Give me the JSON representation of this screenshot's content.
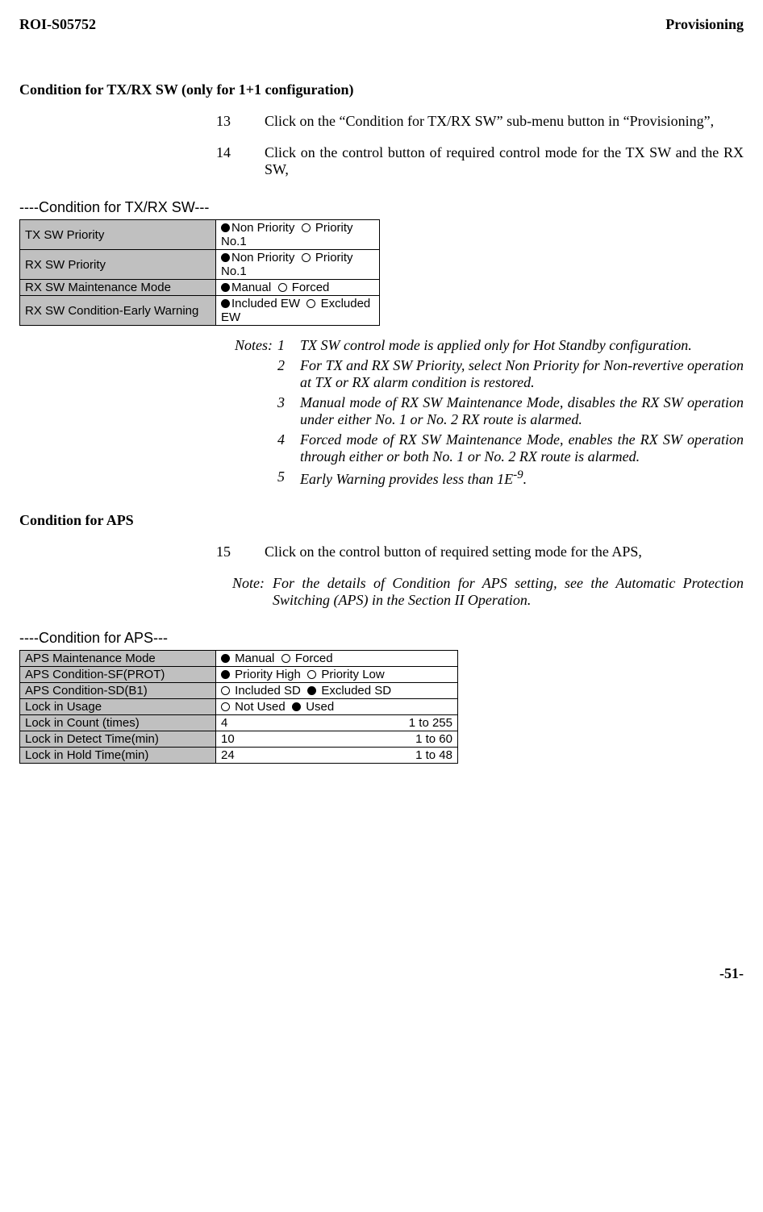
{
  "header": {
    "left": "ROI-S05752",
    "right": "Provisioning"
  },
  "cond_txrx": {
    "title": "Condition for TX/RX SW (only for 1+1 configuration)",
    "step13_num": "13",
    "step13_text": "Click on the “Condition for TX/RX SW” sub-menu button in “Provisioning”,",
    "step14_num": "14",
    "step14_text": "Click on the control button of required control mode for the TX SW and the RX SW,",
    "panel_title": "----Condition for TX/RX SW---",
    "rows": {
      "tx_priority_label": "TX SW Priority",
      "tx_priority_opt1": "Non Priority",
      "tx_priority_opt2": "Priority No.1",
      "rx_priority_label": "RX SW Priority",
      "rx_priority_opt1": "Non Priority",
      "rx_priority_opt2": "Priority No.1",
      "rx_maint_label": "RX SW Maintenance Mode",
      "rx_maint_opt1": "Manual",
      "rx_maint_opt2": "Forced",
      "rx_ew_label": "RX SW Condition-Early Warning",
      "rx_ew_opt1": "Included EW",
      "rx_ew_opt2": "Excluded EW"
    },
    "notes_label": "Notes:",
    "note1_num": "1",
    "note1_text": "TX SW control mode is applied only for Hot Standby configuration.",
    "note2_num": "2",
    "note2_text": "For TX and RX SW Priority, select Non Priority for Non-revertive operation at TX or RX alarm condition is restored.",
    "note3_num": "3",
    "note3_text": "Manual mode of RX SW Maintenance Mode, disables the RX SW operation under either No. 1 or No. 2 RX route is alarmed.",
    "note4_num": "4",
    "note4_text": "Forced mode of RX SW Maintenance Mode, enables the RX SW operation through either or both No. 1 or No. 2 RX route is alarmed.",
    "note5_num": "5",
    "note5_text_pre": "Early Warning provides less than 1E",
    "note5_sup": "-9",
    "note5_post": "."
  },
  "cond_aps": {
    "title": "Condition for APS",
    "step15_num": "15",
    "step15_text": "Click on the control button of required setting mode for the APS,",
    "note_label": "Note:",
    "note_text": "For the details of Condition for APS setting, see the Automatic Protection Switching (APS) in the Section II Operation.",
    "panel_title": "----Condition for APS---",
    "rows": {
      "maint_label": "APS Maintenance Mode",
      "maint_opt1": "Manual",
      "maint_opt2": "Forced",
      "sf_label": "APS Condition-SF(PROT)",
      "sf_opt1": "Priority High",
      "sf_opt2": "Priority Low",
      "sd_label": "APS Condition-SD(B1)",
      "sd_opt1": "Included SD",
      "sd_opt2": "Excluded SD",
      "usage_label": "Lock in Usage",
      "usage_opt1": "Not Used",
      "usage_opt2": "Used",
      "count_label": "Lock in Count (times)",
      "count_val": "4",
      "count_range": "1 to 255",
      "detect_label": "Lock in Detect Time(min)",
      "detect_val": "10",
      "detect_range": "1 to 60",
      "hold_label": "Lock in Hold Time(min)",
      "hold_val": "24",
      "hold_range": "1 to 48"
    }
  },
  "page_num": "-51-"
}
